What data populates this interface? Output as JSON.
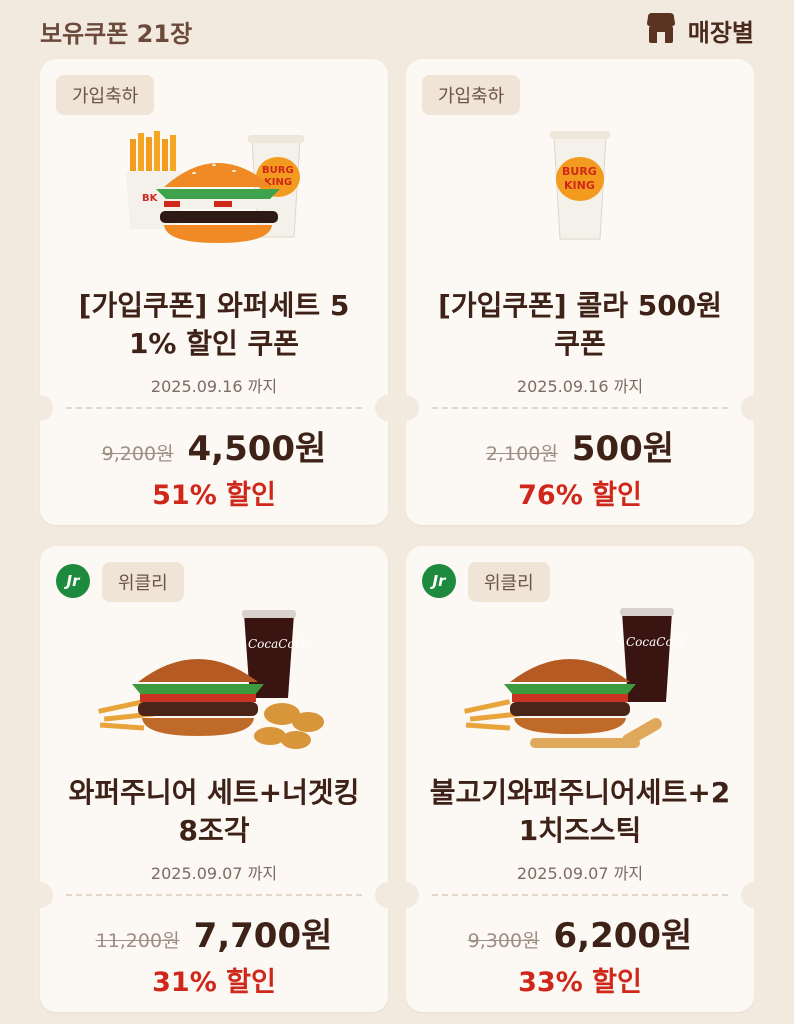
{
  "header": {
    "title": "보유쿠폰 21장",
    "store_label": "매장별",
    "store_icon": "store-icon"
  },
  "colors": {
    "background": "#F3EADF",
    "card": "#FCF8F4",
    "tag_bg": "#EFE4D6",
    "discount": "#D0271B",
    "text": "#3E2218",
    "jr_badge": "#1E8A3E"
  },
  "coupons": [
    {
      "tag": "가입축하",
      "badge": "",
      "name_line1": "[가입쿠폰] 와퍼세트 5",
      "name_line2": "1% 할인 쿠폰",
      "date": "2025.09.16 까지",
      "original_price": "9,200원",
      "price": "4,500원",
      "discount": "51% 할인",
      "image": "whopper-set-illustration"
    },
    {
      "tag": "가입축하",
      "badge": "",
      "name_line1": "[가입쿠폰] 콜라 500원",
      "name_line2": "쿠폰",
      "date": "2025.09.16 까지",
      "original_price": "2,100원",
      "price": "500원",
      "discount": "76% 할인",
      "image": "cola-cup-illustration"
    },
    {
      "tag": "위클리",
      "badge": "Jr",
      "name_line1": "와퍼주니어 세트+너겟킹",
      "name_line2": "8조각",
      "date": "2025.09.07 까지",
      "original_price": "11,200원",
      "price": "7,700원",
      "discount": "31% 할인",
      "image": "whopper-jr-nuggets-photo"
    },
    {
      "tag": "위클리",
      "badge": "Jr",
      "name_line1": "불고기와퍼주니어세트+2",
      "name_line2": "1치즈스틱",
      "date": "2025.09.07 까지",
      "original_price": "9,300원",
      "price": "6,200원",
      "discount": "33% 할인",
      "image": "bulgogi-whopper-jr-cheese-sticks-photo"
    }
  ]
}
